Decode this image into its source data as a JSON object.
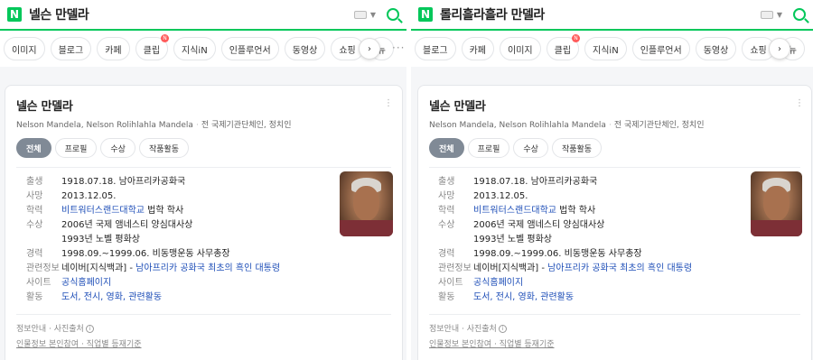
{
  "left": {
    "query": "넬슨 만델라",
    "tabs": [
      "이미지",
      "블로그",
      "카페",
      "클립",
      "지식iN",
      "인플루언서",
      "동영상",
      "쇼핑",
      "뉴"
    ],
    "clip_badge": "N",
    "card": {
      "name": "넬슨 만델라",
      "alt_names": "Nelson Mandela, Nelson Rolihlahla Mandela",
      "occupation": "전 국제기관단체인, 정치인",
      "subtabs": [
        "전체",
        "프로필",
        "수상",
        "작품활동"
      ],
      "rows": [
        {
          "label": "출생",
          "value": "1918.07.18. 남아프리카공화국"
        },
        {
          "label": "사망",
          "value": "2013.12.05."
        },
        {
          "label": "학력",
          "value": "비트워터스랜드대학교",
          "suffix": " 법학 학사"
        },
        {
          "label": "수상",
          "value": "2006년 국제 앰네스티 양심대사상"
        },
        {
          "label": "",
          "value": "1993년 노벨 평화상"
        },
        {
          "label": "경력",
          "value": "1998.09.~1999.06. 비동맹운동 사무총장"
        },
        {
          "label": "관련정보",
          "prefix": "네이버[지식백과] - ",
          "value": "남아프리카 공화국 최초의 흑인 대통령"
        },
        {
          "label": "사이트",
          "value": "공식홈페이지"
        },
        {
          "label": "활동",
          "value": "도서, 전시, 영화, 관련활동"
        }
      ],
      "footer_line1": "정보안내 · 사진출처",
      "footer_line2": "인물정보 본인참여 · 직업별 등재기준"
    }
  },
  "right": {
    "query": "롤리흘라흘라 만델라",
    "tabs": [
      "블로그",
      "카페",
      "이미지",
      "클립",
      "지식iN",
      "인플루언서",
      "동영상",
      "쇼핑",
      "뉴"
    ],
    "clip_badge": "N",
    "card": {
      "name": "넬슨 만델라",
      "alt_names": "Nelson Mandela, Nelson Rolihlahla Mandela",
      "occupation": "전 국제기관단체인, 정치인",
      "subtabs": [
        "전체",
        "프로필",
        "수상",
        "작품활동"
      ],
      "rows": [
        {
          "label": "출생",
          "value": "1918.07.18. 남아프리카공화국"
        },
        {
          "label": "사망",
          "value": "2013.12.05."
        },
        {
          "label": "학력",
          "value": "비트워터스랜드대학교",
          "suffix": " 법학 학사"
        },
        {
          "label": "수상",
          "value": "2006년 국제 앰네스티 양심대사상"
        },
        {
          "label": "",
          "value": "1993년 노벨 평화상"
        },
        {
          "label": "경력",
          "value": "1998.09.~1999.06. 비동맹운동 사무총장"
        },
        {
          "label": "관련정보",
          "prefix": "네이버[지식백과] - ",
          "value": "남아프리카 공화국 최초의 흑인 대통령"
        },
        {
          "label": "사이트",
          "value": "공식홈페이지"
        },
        {
          "label": "활동",
          "value": "도서, 전시, 영화, 관련활동"
        }
      ],
      "footer_line1": "정보안내 · 사진출처",
      "footer_line2": "인물정보 본인참여 · 직업별 등재기준"
    }
  },
  "logo_letter": "N",
  "icons": {
    "search": "search-icon",
    "keyboard": "keyboard-icon",
    "next": "chevron-right-icon",
    "more": "more-dots-icon",
    "kebab": "kebab-icon",
    "info": "info-icon"
  },
  "colors": {
    "brand": "#03c75a",
    "link": "#1f4fb8",
    "active_subtab": "#808a96"
  }
}
